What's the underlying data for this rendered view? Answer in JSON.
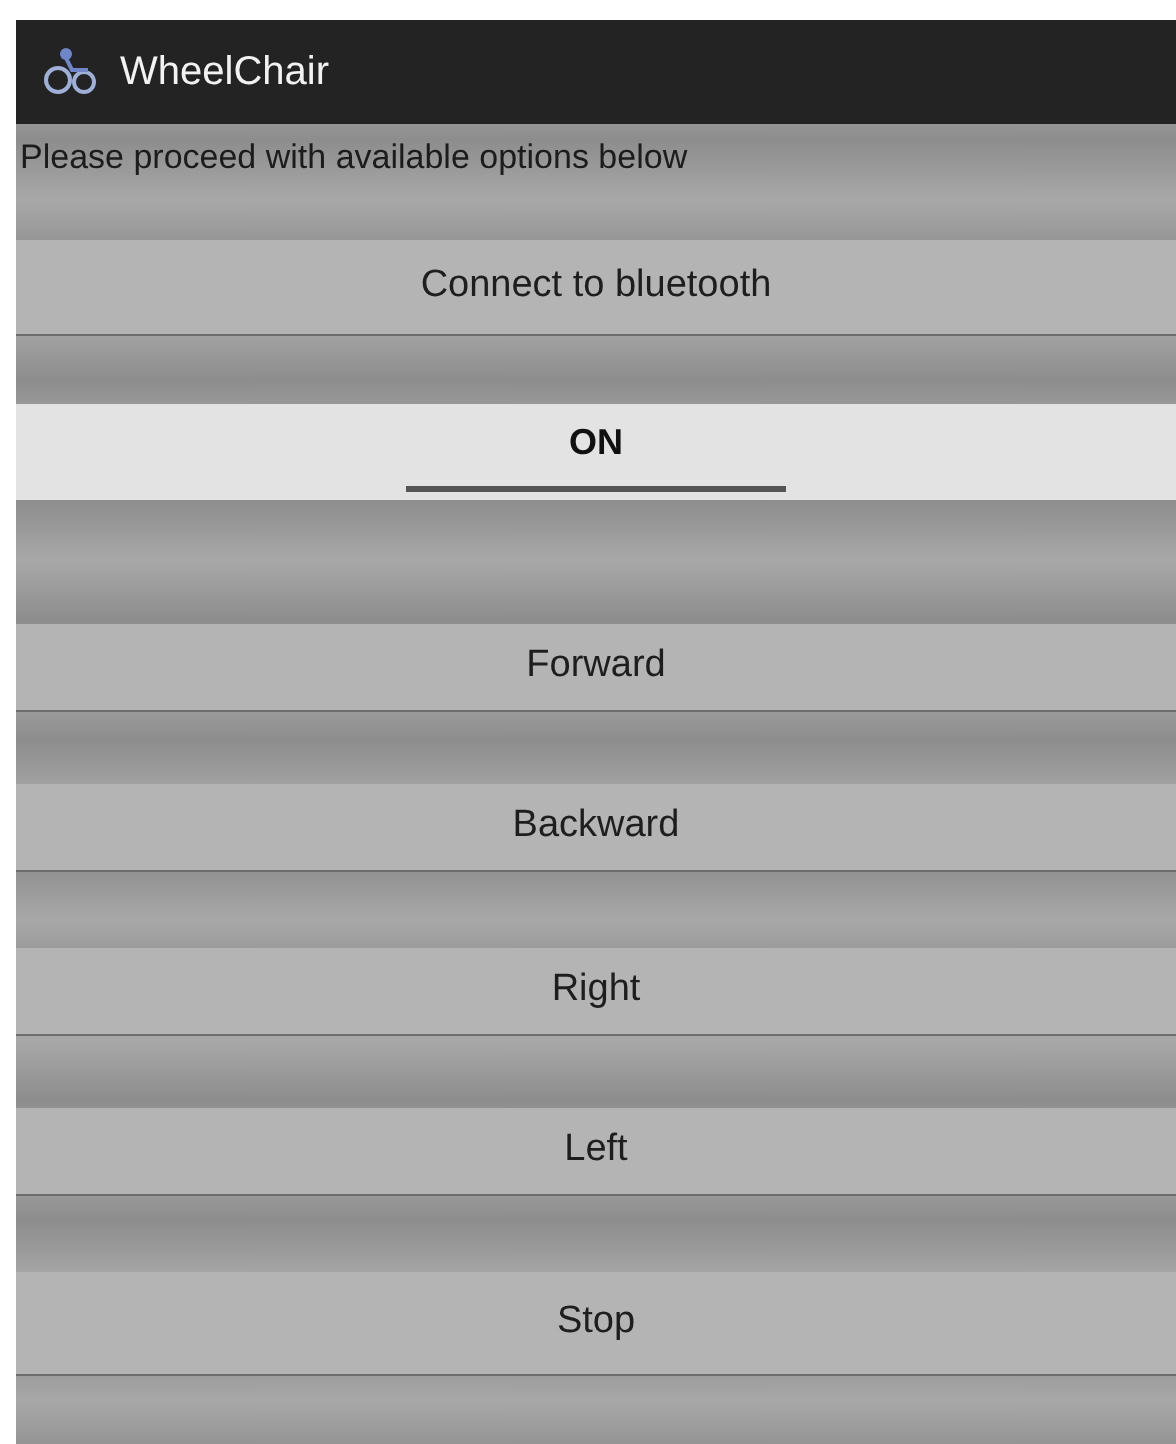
{
  "app_bar": {
    "title": "WheelChair"
  },
  "instruction": "Please proceed with available options below",
  "connect_button": {
    "label": "Connect to bluetooth"
  },
  "toggle": {
    "label": "ON",
    "on": true
  },
  "direction_buttons": [
    {
      "label": "Forward"
    },
    {
      "label": "Backward"
    },
    {
      "label": "Right"
    },
    {
      "label": "Left"
    },
    {
      "label": "Stop"
    }
  ]
}
